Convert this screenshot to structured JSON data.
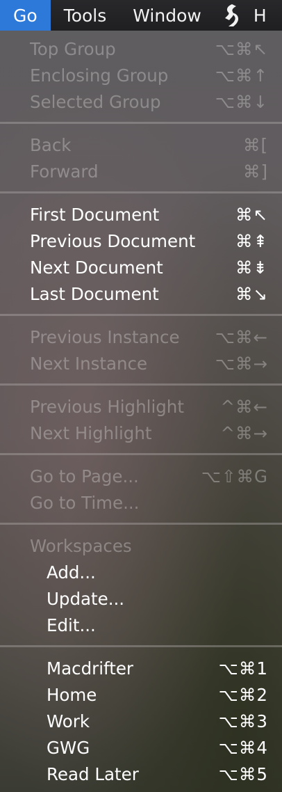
{
  "menubar": {
    "items": [
      {
        "label": "Go",
        "active": true
      },
      {
        "label": "Tools"
      },
      {
        "label": "Window"
      },
      {
        "label": "H"
      }
    ],
    "script_icon": "script-menu-icon"
  },
  "menu": {
    "groups": [
      {
        "items": [
          {
            "label": "Top Group",
            "shortcut": "⌥⌘↖",
            "enabled": false
          },
          {
            "label": "Enclosing Group",
            "shortcut": "⌥⌘↑",
            "enabled": false
          },
          {
            "label": "Selected Group",
            "shortcut": "⌥⌘↓",
            "enabled": false
          }
        ]
      },
      {
        "items": [
          {
            "label": "Back",
            "shortcut": "⌘[",
            "enabled": false
          },
          {
            "label": "Forward",
            "shortcut": "⌘]",
            "enabled": false
          }
        ]
      },
      {
        "items": [
          {
            "label": "First Document",
            "shortcut": "⌘↖",
            "enabled": true
          },
          {
            "label": "Previous Document",
            "shortcut": "⌘⇞",
            "enabled": true
          },
          {
            "label": "Next Document",
            "shortcut": "⌘⇟",
            "enabled": true
          },
          {
            "label": "Last Document",
            "shortcut": "⌘↘",
            "enabled": true
          }
        ]
      },
      {
        "items": [
          {
            "label": "Previous Instance",
            "shortcut": "⌥⌘←",
            "enabled": false
          },
          {
            "label": "Next Instance",
            "shortcut": "⌥⌘→",
            "enabled": false
          }
        ]
      },
      {
        "items": [
          {
            "label": "Previous Highlight",
            "shortcut": "^⌘←",
            "enabled": false
          },
          {
            "label": "Next Highlight",
            "shortcut": "^⌘→",
            "enabled": false
          }
        ]
      },
      {
        "items": [
          {
            "label": "Go to Page...",
            "shortcut": "⌥⇧⌘G",
            "enabled": false
          },
          {
            "label": "Go to Time...",
            "shortcut": "",
            "enabled": false
          }
        ]
      },
      {
        "header": "Workspaces",
        "items": [
          {
            "label": "Add...",
            "shortcut": "",
            "enabled": true
          },
          {
            "label": "Update...",
            "shortcut": "",
            "enabled": true
          },
          {
            "label": "Edit...",
            "shortcut": "",
            "enabled": true
          }
        ]
      },
      {
        "items": [
          {
            "label": "Macdrifter",
            "shortcut": "⌥⌘1",
            "enabled": true
          },
          {
            "label": "Home",
            "shortcut": "⌥⌘2",
            "enabled": true
          },
          {
            "label": "Work",
            "shortcut": "⌥⌘3",
            "enabled": true
          },
          {
            "label": "GWG",
            "shortcut": "⌥⌘4",
            "enabled": true
          },
          {
            "label": "Read Later",
            "shortcut": "⌥⌘5",
            "enabled": true
          }
        ]
      }
    ]
  }
}
